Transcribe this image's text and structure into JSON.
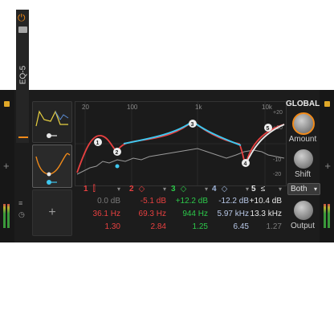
{
  "device": {
    "title": "EQ-5",
    "add_symbol": "+"
  },
  "graph": {
    "freq_labels": [
      "20",
      "100",
      "1k",
      "10k"
    ],
    "db_labels": [
      "+20",
      "+10",
      "-10",
      "-20"
    ]
  },
  "bands": [
    {
      "num": "1",
      "gain": "0.0 dB",
      "freq": "36.1 Hz",
      "q": "1.30",
      "color": "#e84040",
      "active": true
    },
    {
      "num": "2",
      "gain": "-5.1 dB",
      "freq": "69.3 Hz",
      "q": "2.84",
      "color": "#e84040",
      "active": true
    },
    {
      "num": "3",
      "gain": "+12.2 dB",
      "freq": "944 Hz",
      "q": "1.25",
      "color": "#2cc84a",
      "active": true
    },
    {
      "num": "4",
      "gain": "-12.2 dB",
      "freq": "5.97 kHz",
      "q": "6.45",
      "color": "#9fb4d8",
      "active": true
    },
    {
      "num": "5",
      "gain": "+10.4 dB",
      "freq": "13.3 kHz",
      "q": "1.27",
      "color": "#e8e8e8",
      "active": true
    }
  ],
  "global": {
    "title": "GLOBAL",
    "amount_label": "Amount",
    "shift_label": "Shift",
    "mode_value": "Both",
    "output_label": "Output"
  },
  "colors": {
    "accent": "#f08a1a",
    "band_red": "#e84040",
    "band_green": "#2cc84a",
    "band_blue": "#9fb4d8",
    "curve_cyan": "#3ec8f0",
    "curve_yellow": "#e8d040"
  },
  "icons": [
    "power-icon",
    "folder-icon",
    "plus-icon",
    "chevron-down-icon"
  ]
}
